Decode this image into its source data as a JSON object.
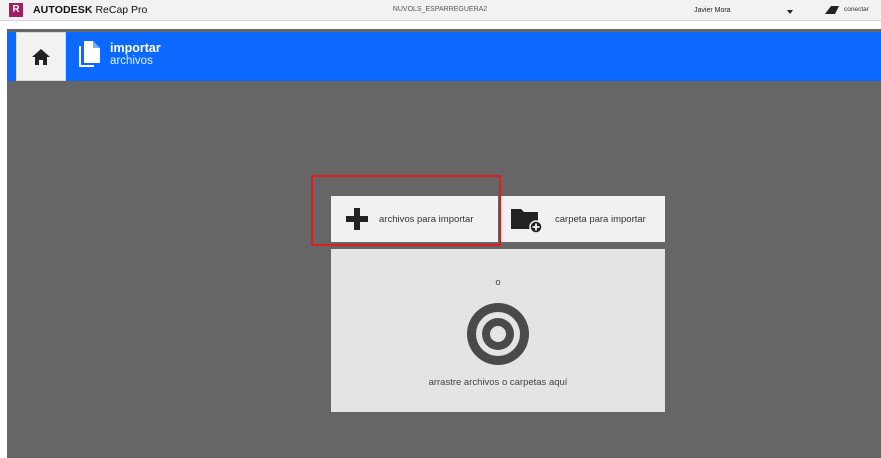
{
  "titlebar": {
    "app_logo_letter": "R",
    "app_brand": "AUTODESK",
    "app_product": "ReCap Pro",
    "project_name": "NUVOLS_ESPARREGUERA2",
    "user_name": "Javier Mora",
    "user_menu_icon": "caret-down-icon",
    "connect_label": "conectar",
    "connect_icon": "autodesk-a-icon"
  },
  "banner": {
    "home_icon": "home-icon",
    "section_icon": "documents-icon",
    "title": "importar",
    "subtitle": "archivos",
    "background_color": "#0b69ff"
  },
  "import_options": {
    "files": {
      "label": "archivos para importar",
      "icon": "plus-icon"
    },
    "folder": {
      "label": "carpeta para importar",
      "icon": "folder-add-icon"
    }
  },
  "drop_zone": {
    "or_text": "o",
    "icon": "target-icon",
    "text": "arrastre archivos o carpetas aquí"
  },
  "colors": {
    "workspace": "#666666",
    "highlight": "#e01c1c",
    "panel": "#f1f1f1",
    "drop_zone": "#e4e4e4"
  }
}
